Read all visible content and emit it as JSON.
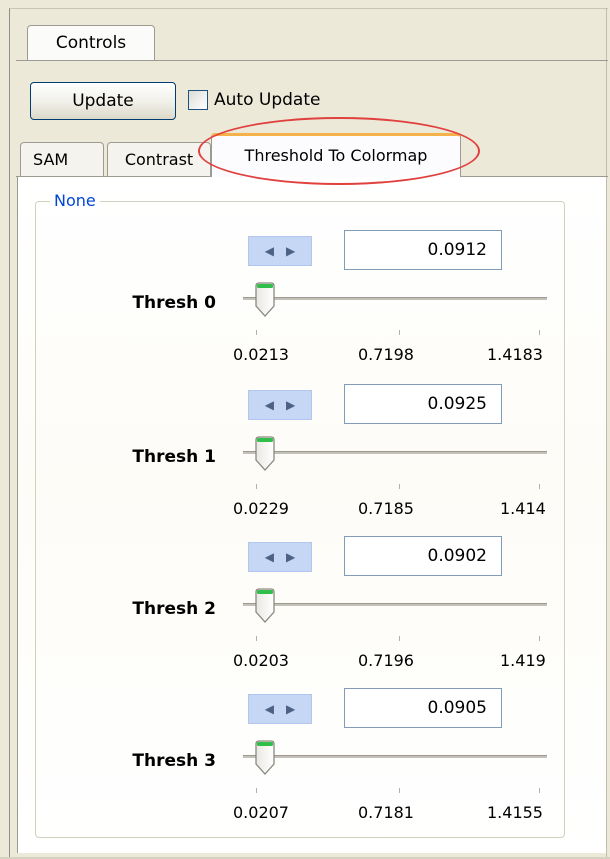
{
  "top_tab": {
    "label": "Controls"
  },
  "toolbar": {
    "update_label": "Update",
    "auto_update_label": "Auto Update",
    "auto_update_checked": false
  },
  "tabs": [
    {
      "label": "SAM"
    },
    {
      "label": "Contrast"
    },
    {
      "label": "Threshold To Colormap",
      "selected": true
    }
  ],
  "group": {
    "title": "None"
  },
  "thresholds": [
    {
      "label": "Thresh 0",
      "value": "0.0912",
      "ticks": [
        "0.0213",
        "0.7198",
        "1.4183"
      ]
    },
    {
      "label": "Thresh 1",
      "value": "0.0925",
      "ticks": [
        "0.0229",
        "0.7185",
        "1.414"
      ]
    },
    {
      "label": "Thresh 2",
      "value": "0.0902",
      "ticks": [
        "0.0203",
        "0.7196",
        "1.419"
      ]
    },
    {
      "label": "Thresh 3",
      "value": "0.0905",
      "ticks": [
        "0.0207",
        "0.7181",
        "1.4155"
      ]
    }
  ],
  "icons": {
    "spin_left": "◀",
    "spin_right": "▶"
  },
  "colors": {
    "highlight": "#e0413f",
    "group_title": "#0046d5",
    "selected_tab_accent": "#f5b24b"
  }
}
